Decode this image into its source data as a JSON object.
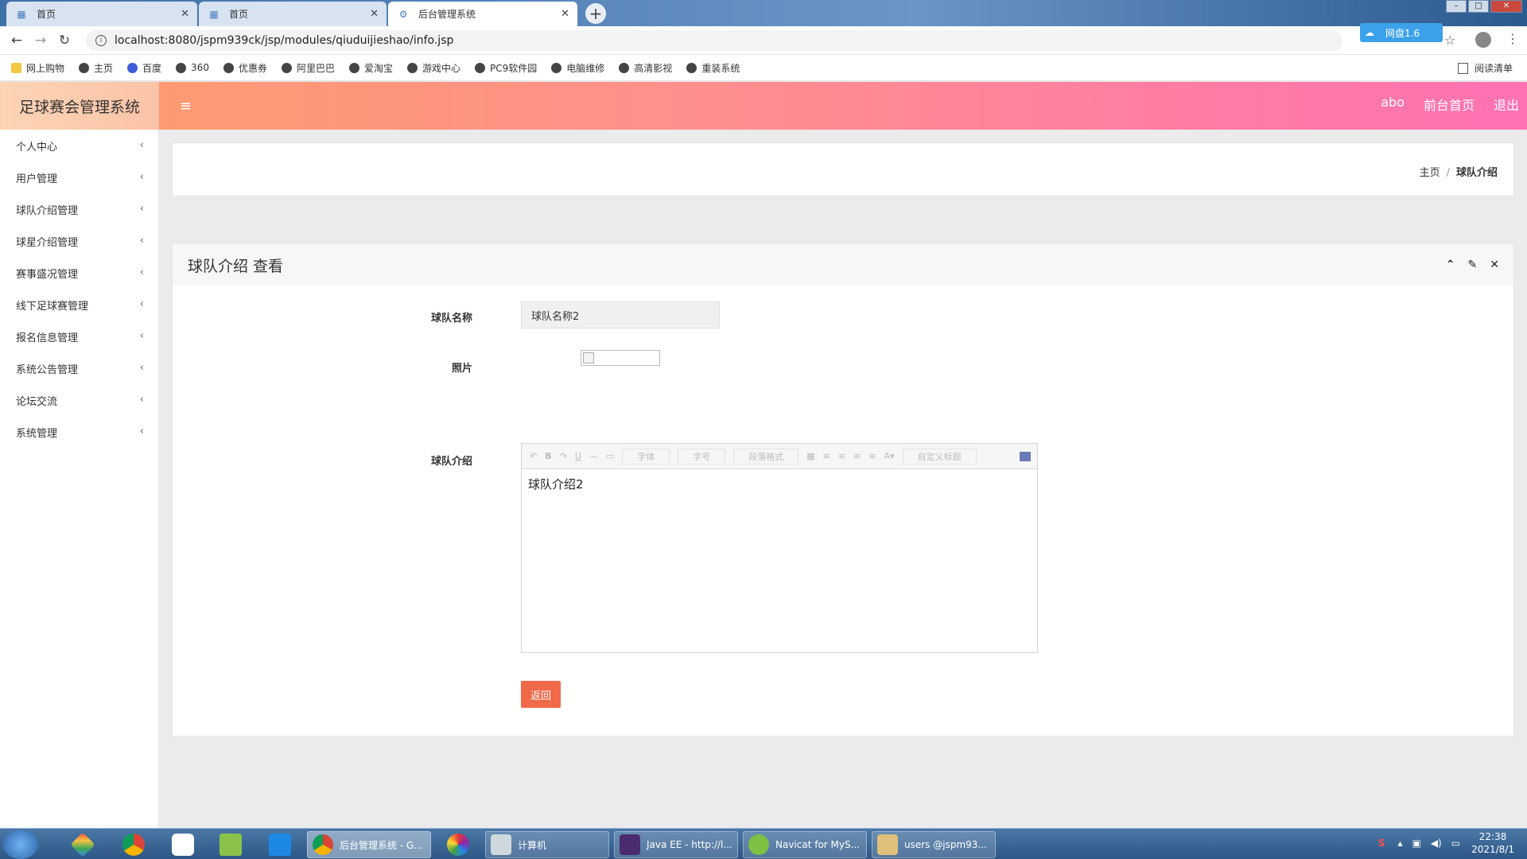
{
  "browser": {
    "tabs": [
      {
        "label": "首页"
      },
      {
        "label": "首页"
      },
      {
        "label": "后台管理系统"
      }
    ],
    "url": "localhost:8080/jspm939ck/jsp/modules/qiuduijieshao/info.jsp",
    "baidu_button": "网盘1.6",
    "bookmarks": [
      "网上购物",
      "主页",
      "百度",
      "360",
      "优惠券",
      "阿里巴巴",
      "爱淘宝",
      "游戏中心",
      "PC9软件园",
      "电脑维修",
      "高清影视",
      "重装系统"
    ],
    "reading_list": "阅读清单"
  },
  "header": {
    "app_title": "足球赛会管理系统",
    "links": [
      "abo",
      "前台首页",
      "退出"
    ]
  },
  "sidebar": {
    "items": [
      {
        "label": "个人中心"
      },
      {
        "label": "用户管理"
      },
      {
        "label": "球队介绍管理"
      },
      {
        "label": "球星介绍管理"
      },
      {
        "label": "赛事盛况管理"
      },
      {
        "label": "线下足球赛管理"
      },
      {
        "label": "报名信息管理"
      },
      {
        "label": "系统公告管理"
      },
      {
        "label": "论坛交流"
      },
      {
        "label": "系统管理"
      }
    ]
  },
  "breadcrumb": {
    "home": "主页",
    "current": "球队介绍"
  },
  "card": {
    "title": "球队介绍 查看",
    "fields": {
      "name_label": "球队名称",
      "name_value": "球队名称2",
      "photo_label": "照片",
      "intro_label": "球队介绍",
      "intro_content": "球队介绍2"
    },
    "editor_toolbar": {
      "font": "字体",
      "size": "字号",
      "para": "段落格式",
      "custom": "自定义标题"
    },
    "back_button": "返回"
  },
  "taskbar": {
    "tasks": [
      "后台管理系统 - G...",
      "计算机",
      "Java EE - http://l...",
      "Navicat for MyS...",
      "users @jspm93..."
    ],
    "time": "22:38",
    "date": "2021/8/1"
  }
}
